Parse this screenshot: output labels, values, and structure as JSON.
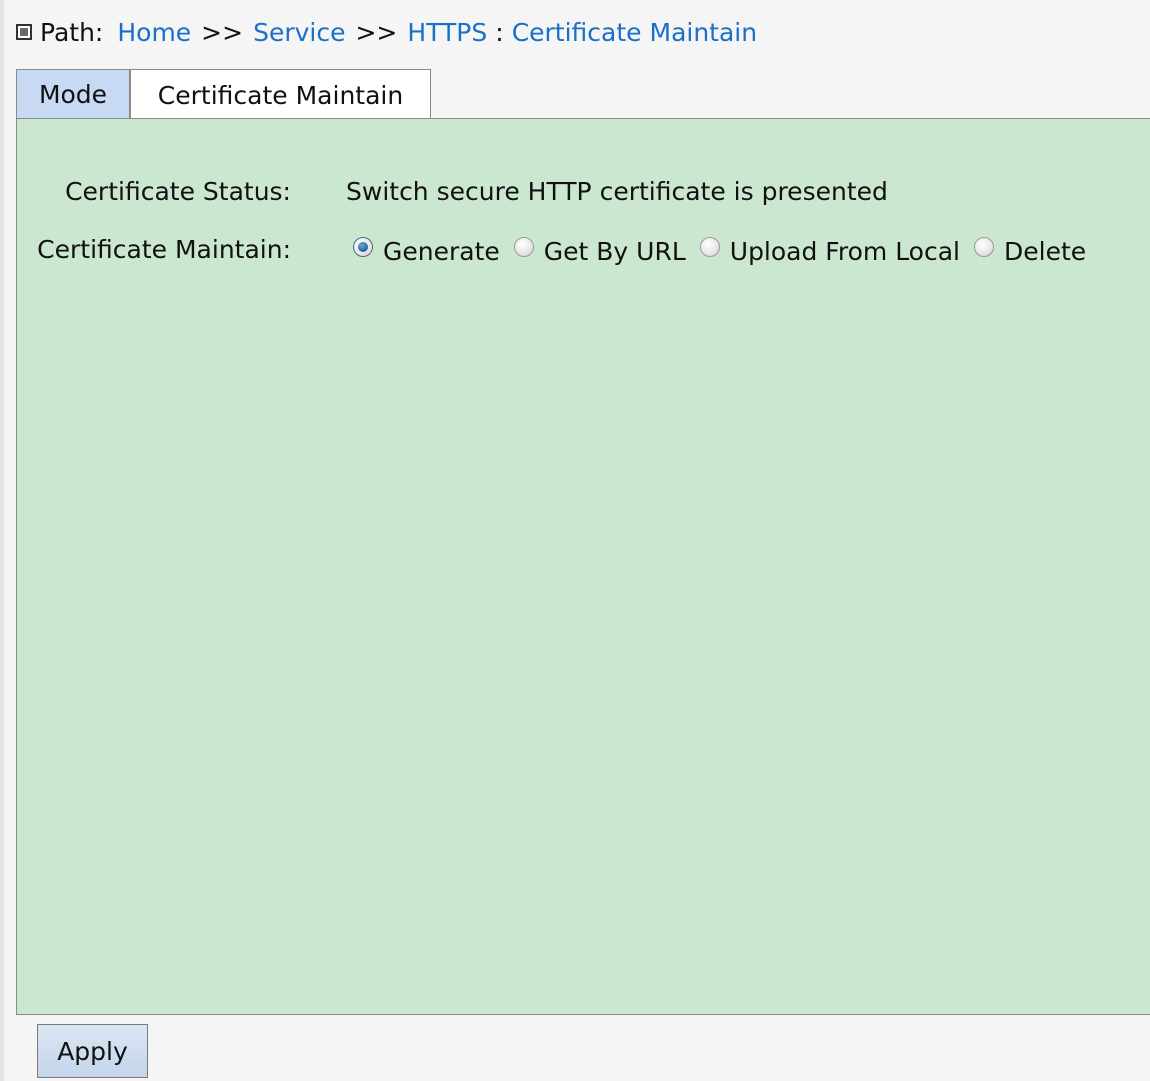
{
  "breadcrumb": {
    "label": "Path:",
    "links": [
      "Home",
      "Service",
      "HTTPS"
    ],
    "separator": ">>",
    "current_sep": ":",
    "current": "Certificate Maintain"
  },
  "tabs": [
    {
      "label": "Mode",
      "active": false
    },
    {
      "label": "Certificate Maintain",
      "active": true
    }
  ],
  "form": {
    "status_label": "Certificate Status:",
    "status_value": "Switch secure HTTP certificate is presented",
    "maintain_label": "Certificate Maintain:",
    "maintain_options": [
      "Generate",
      "Get By URL",
      "Upload From Local",
      "Delete"
    ],
    "maintain_selected": "Generate"
  },
  "actions": {
    "apply_label": "Apply"
  },
  "colors": {
    "link": "#1a6fc9",
    "panel_bg": "#cce7d0",
    "inactive_tab_bg": "#c7d9f3"
  }
}
